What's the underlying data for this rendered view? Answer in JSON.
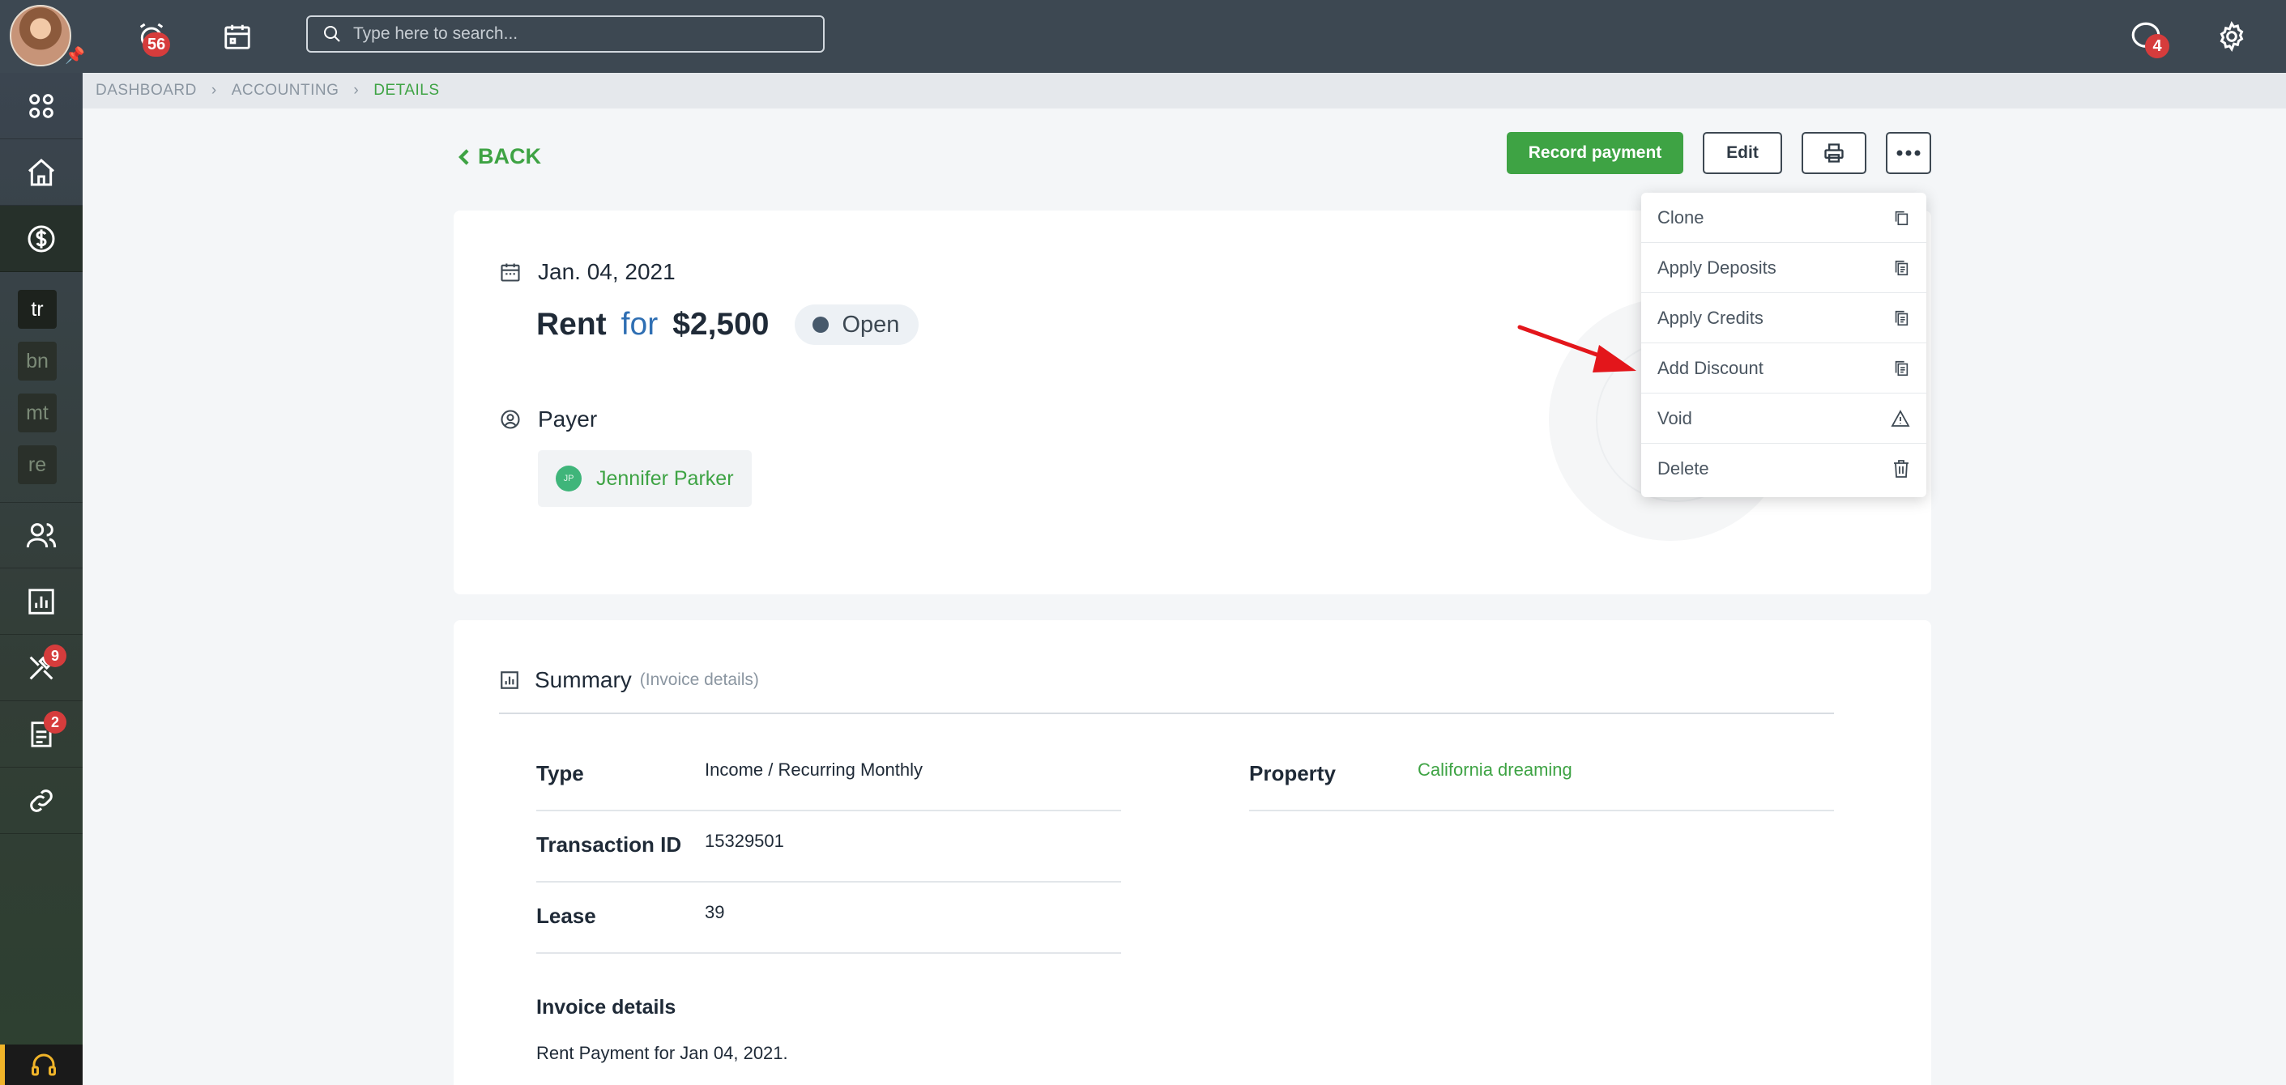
{
  "topbar": {
    "alerts_badge": "56",
    "search_placeholder": "Type here to search...",
    "messages_badge": "4"
  },
  "sidebar": {
    "abbreviations": [
      "tr",
      "bn",
      "mt",
      "re"
    ],
    "maintenance_badge": "9",
    "tasks_badge": "2"
  },
  "breadcrumb": {
    "items": [
      "DASHBOARD",
      "ACCOUNTING",
      "DETAILS"
    ]
  },
  "header": {
    "back_label": "BACK",
    "record_payment_label": "Record payment",
    "edit_label": "Edit"
  },
  "transaction": {
    "date": "Jan. 04, 2021",
    "category": "Rent",
    "for_word": "for",
    "amount": "$2,500",
    "status": "Open",
    "payer_heading": "Payer",
    "payer_initials": "JP",
    "payer_name": "Jennifer Parker"
  },
  "summary": {
    "heading": "Summary",
    "subheading": "(Invoice details)",
    "fields": [
      {
        "label": "Type",
        "value": "Income / Recurring Monthly"
      },
      {
        "label": "Transaction ID",
        "value": "15329501"
      },
      {
        "label": "Lease",
        "value": "39"
      }
    ],
    "property_label": "Property",
    "property_value": "California dreaming",
    "invoice_details_heading": "Invoice details",
    "invoice_details_text": "Rent Payment for Jan 04, 2021."
  },
  "dropdown": {
    "items": [
      {
        "label": "Clone",
        "icon": "copy-icon"
      },
      {
        "label": "Apply Deposits",
        "icon": "documents-icon"
      },
      {
        "label": "Apply Credits",
        "icon": "documents-icon"
      },
      {
        "label": "Add Discount",
        "icon": "documents-icon"
      },
      {
        "label": "Void",
        "icon": "warning-icon"
      },
      {
        "label": "Delete",
        "icon": "trash-icon"
      }
    ]
  },
  "colors": {
    "accent_green": "#3ea344",
    "topbar": "#3d4852",
    "badge_red": "#d63c3c",
    "annotation_arrow": "#e3161b"
  }
}
